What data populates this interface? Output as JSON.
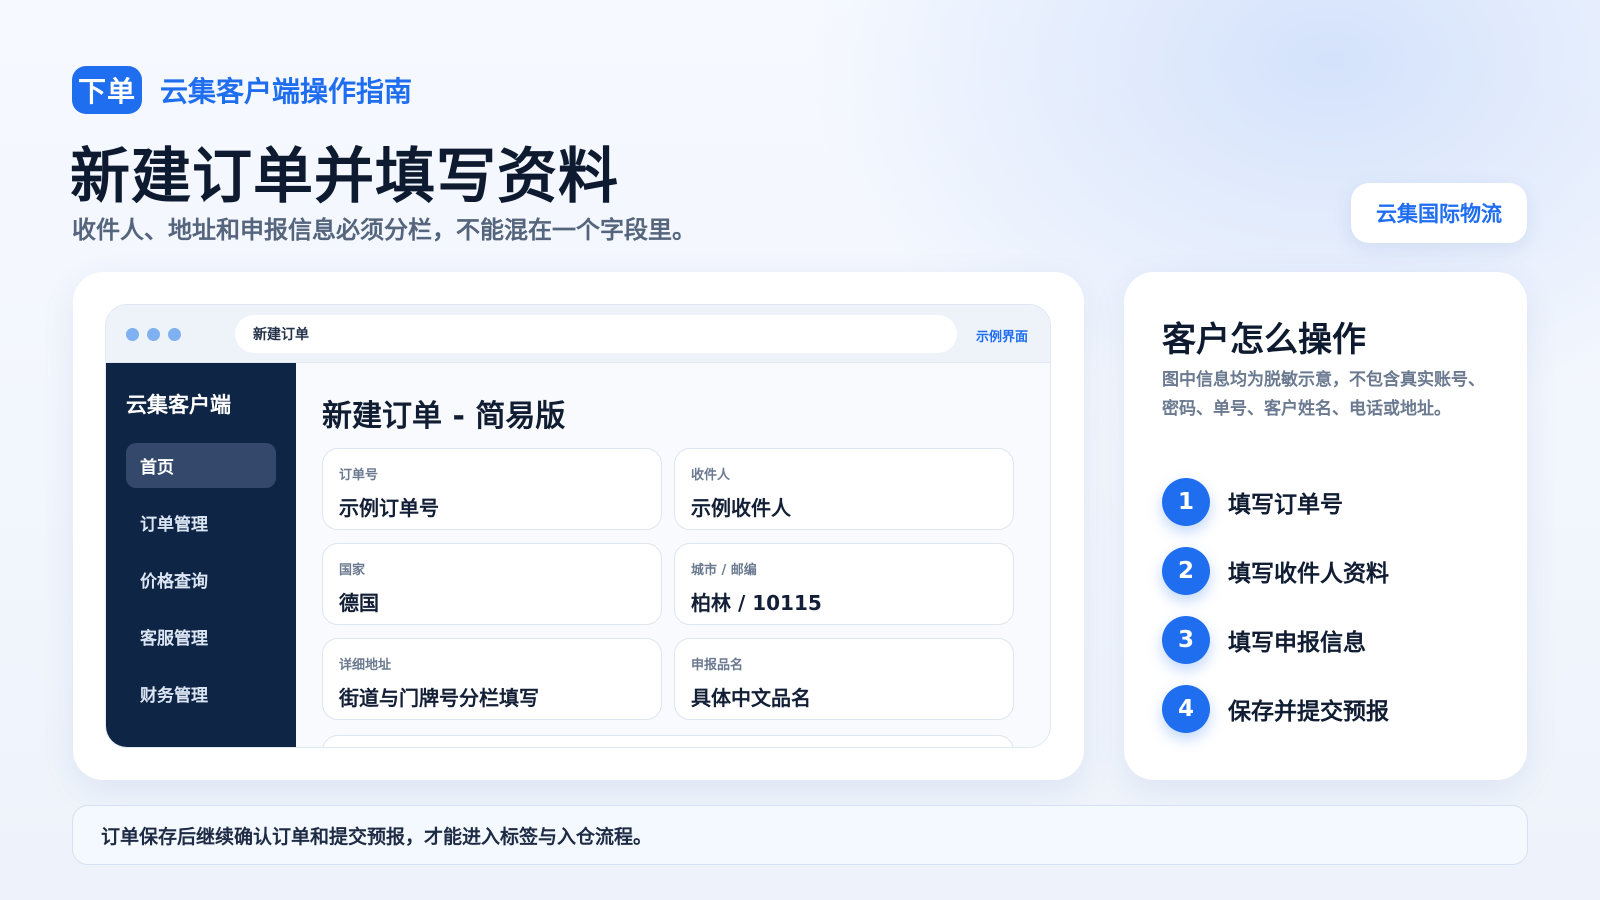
{
  "header": {
    "badge": "下单",
    "guide_title": "云集客户端操作指南",
    "title": "新建订单并填写资料",
    "subtitle": "收件人、地址和申报信息必须分栏，不能混在一个字段里。",
    "brand": "云集国际物流"
  },
  "browser": {
    "url_text": "新建订单",
    "sample_label": "示例界面"
  },
  "sidebar": {
    "title": "云集客户端",
    "items": [
      {
        "label": "首页",
        "active": true
      },
      {
        "label": "订单管理",
        "active": false
      },
      {
        "label": "价格查询",
        "active": false
      },
      {
        "label": "客服管理",
        "active": false
      },
      {
        "label": "财务管理",
        "active": false
      }
    ]
  },
  "form": {
    "title": "新建订单 - 简易版",
    "fields": [
      {
        "label": "订单号",
        "value": "示例订单号"
      },
      {
        "label": "收件人",
        "value": "示例收件人"
      },
      {
        "label": "国家",
        "value": "德国"
      },
      {
        "label": "城市 / 邮编",
        "value": "柏林 / 10115"
      },
      {
        "label": "详细地址",
        "value": "街道与门牌号分栏填写"
      },
      {
        "label": "申报品名",
        "value": "具体中文品名"
      }
    ]
  },
  "steps": {
    "title": "客户怎么操作",
    "note": "图中信息均为脱敏示意，不包含真实账号、密码、单号、客户姓名、电话或地址。",
    "items": [
      {
        "num": "1",
        "label": "填写订单号"
      },
      {
        "num": "2",
        "label": "填写收件人资料"
      },
      {
        "num": "3",
        "label": "填写申报信息"
      },
      {
        "num": "4",
        "label": "保存并提交预报"
      }
    ]
  },
  "footer": {
    "note": "订单保存后继续确认订单和提交预报，才能进入标签与入仓流程。"
  },
  "colors": {
    "accent": "#1f6ef0",
    "sidebar_bg": "#0e2545",
    "sidebar_active": "#33486a"
  }
}
